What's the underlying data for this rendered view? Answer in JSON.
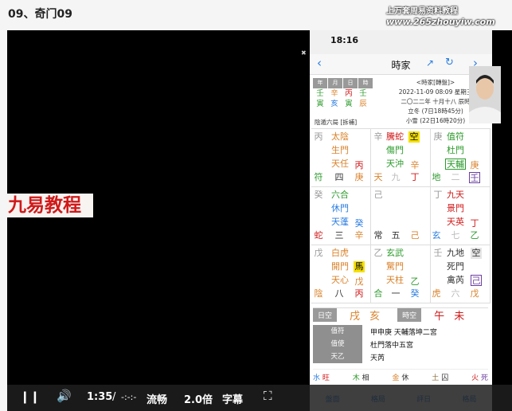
{
  "page": {
    "title": "09、奇门09"
  },
  "video": {
    "banner_text": "九易教程",
    "small_mark": "✖",
    "overlay_title": "上万套周易资料教程",
    "overlay_url": "www.265zhouyiw.com"
  },
  "phone": {
    "status_time": "18:16",
    "nav": {
      "back": "‹",
      "title": "時家",
      "share": "↗",
      "refresh": "↻",
      "forward": "›"
    },
    "pillars": {
      "headers": [
        "年",
        "月",
        "日",
        "時"
      ],
      "stems": [
        "壬",
        "辛",
        "丙",
        "壬"
      ],
      "branches": [
        "寅",
        "亥",
        "寅",
        "辰"
      ]
    },
    "ju": "陰遁六局 [拆補]",
    "info": [
      "<時家[轉盤]>",
      "2022-11-09 08:09 星期三",
      "二〇二二年 十月十八 辰時",
      "立冬 (7日18時45分)",
      "小雪 (22日16時20分)"
    ],
    "grid": {
      "c1": [
        "丙",
        "太陰",
        "生門",
        "天任",
        "丙",
        "符",
        "四",
        "庚"
      ],
      "c2": [
        "辛",
        "騰蛇",
        "空",
        "傷門",
        "天沖",
        "辛",
        "天",
        "九",
        "丁"
      ],
      "c3": [
        "庚",
        "值符",
        "杜門",
        "天輔",
        "庚",
        "地",
        "二",
        "壬"
      ],
      "c4": [
        "癸",
        "六合",
        "休門",
        "天蓬",
        "癸",
        "蛇",
        "三",
        "辛"
      ],
      "c5": [
        "己",
        "常",
        "五",
        "己"
      ],
      "c6": [
        "丁",
        "九天",
        "景門",
        "天英",
        "丁",
        "玄",
        "七",
        "乙"
      ],
      "c7": [
        "戊",
        "白虎",
        "開門",
        "馬",
        "天心",
        "戊",
        "陰",
        "八",
        "丙"
      ],
      "c8": [
        "乙",
        "玄武",
        "驚門",
        "天柱",
        "乙",
        "合",
        "一",
        "癸"
      ],
      "c9": [
        "壬",
        "九地",
        "空",
        "死門",
        "禽芮",
        "己",
        "虎",
        "六",
        "戊"
      ]
    },
    "daybar": {
      "day_label": "日空",
      "day_values": "戌 亥",
      "hour_label": "時空",
      "hour_values": "午 未"
    },
    "legend": [
      {
        "key": "值符",
        "value": "甲申庚  天輔落坤二宮"
      },
      {
        "key": "值使",
        "value": "杜門落中五宮"
      },
      {
        "key": "天乙",
        "value": "天芮"
      }
    ],
    "wuxing": [
      {
        "element": "水",
        "state": "旺"
      },
      {
        "element": "木",
        "state": "相"
      },
      {
        "element": "金",
        "state": "休"
      },
      {
        "element": "土",
        "state": "囚"
      },
      {
        "element": "火",
        "state": "死"
      }
    ],
    "tabs": [
      "盤面",
      "格局",
      "評日",
      "格局"
    ]
  },
  "controls": {
    "time": "1:35",
    "separator": "/",
    "duration": "-:-:-",
    "quality": "流畅",
    "speed": "2.0倍",
    "subtitle": "字幕"
  },
  "colors": {
    "red": "#d01a1a",
    "green": "#2c9a2c",
    "orange": "#d9822b",
    "blue": "#2b7de1"
  }
}
